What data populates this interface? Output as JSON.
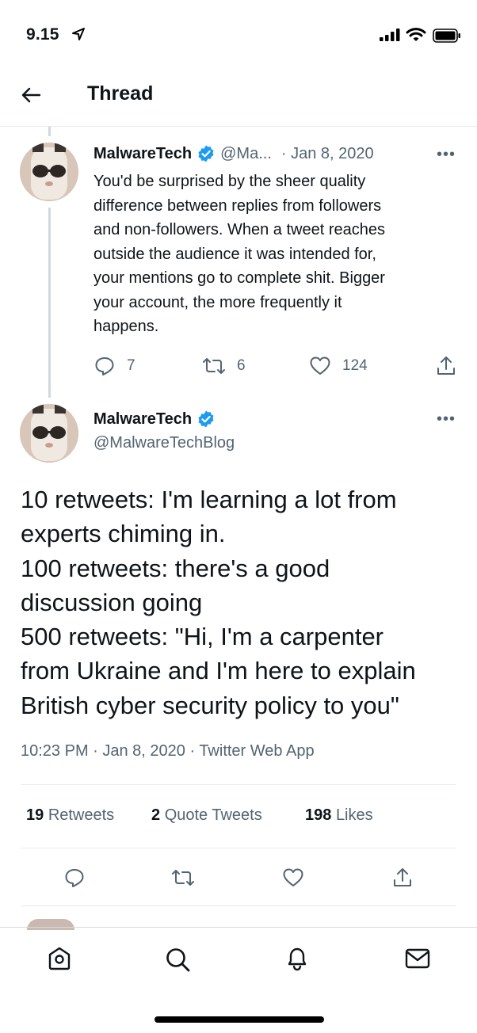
{
  "status_bar": {
    "time": "9.15"
  },
  "header": {
    "title": "Thread"
  },
  "parent_tweet": {
    "name": "MalwareTech",
    "handle_truncated": "@Ma...",
    "date": "· Jan 8, 2020",
    "text_lines": [
      "You'd be surprised by the sheer quality",
      "difference between replies from followers",
      "and non-followers. When a tweet reaches",
      "outside the audience it was intended for,",
      "your mentions go to complete shit. Bigger",
      "your account, the more frequently it",
      "happens."
    ],
    "replies": "7",
    "retweets": "6",
    "likes": "124"
  },
  "main_tweet": {
    "name": "MalwareTech",
    "handle": "@MalwareTechBlog",
    "text_lines": [
      "10 retweets: I'm learning a lot from",
      "experts chiming in.",
      "100 retweets: there's a good",
      "discussion going",
      "500 retweets: \"Hi, I'm a carpenter",
      "from Ukraine and I'm here to explain",
      "British cyber security policy to you\""
    ],
    "meta": "10:23 PM · Jan 8, 2020 · Twitter Web App",
    "stats": {
      "retweets_count": "19",
      "retweets_label": "Retweets",
      "quotes_count": "2",
      "quotes_label": "Quote Tweets",
      "likes_count": "198",
      "likes_label": "Likes"
    }
  },
  "colors": {
    "accent": "#1d9bf0",
    "muted": "#536471",
    "divider": "#e6ecf0"
  },
  "icons": [
    "back-arrow-icon",
    "verified-icon",
    "more-icon",
    "reply-icon",
    "retweet-icon",
    "like-icon",
    "share-icon",
    "home-icon",
    "search-icon",
    "notifications-icon",
    "messages-icon"
  ]
}
